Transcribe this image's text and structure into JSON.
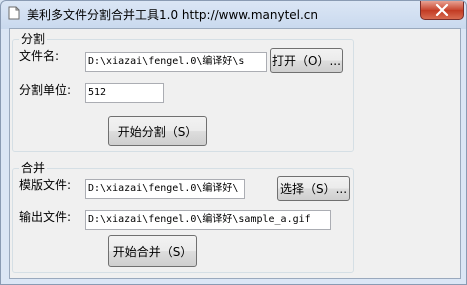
{
  "window": {
    "title": "美利多文件分割合并工具1.0 http://www.manytel.cn"
  },
  "split": {
    "group_label": "分割",
    "file_label": "文件名:",
    "file_value": "D:\\xiazai\\fengel.0\\编译好\\s",
    "open_button": "打开（O）...",
    "unit_label": "分割单位:",
    "unit_value": "512",
    "start_button": "开始分割（S）"
  },
  "merge": {
    "group_label": "合并",
    "template_label": "模版文件:",
    "template_value": "D:\\xiazai\\fengel.0\\编译好\\",
    "select_button": "选择（S）...",
    "output_label": "输出文件:",
    "output_value": "D:\\xiazai\\fengel.0\\编译好\\sample_a.gif",
    "start_button": "开始合并（S）"
  },
  "icons": {
    "app": "document-icon",
    "close": "close-icon"
  },
  "colors": {
    "close_button": "#c8462f",
    "titlebar": "#c9d9ee"
  }
}
